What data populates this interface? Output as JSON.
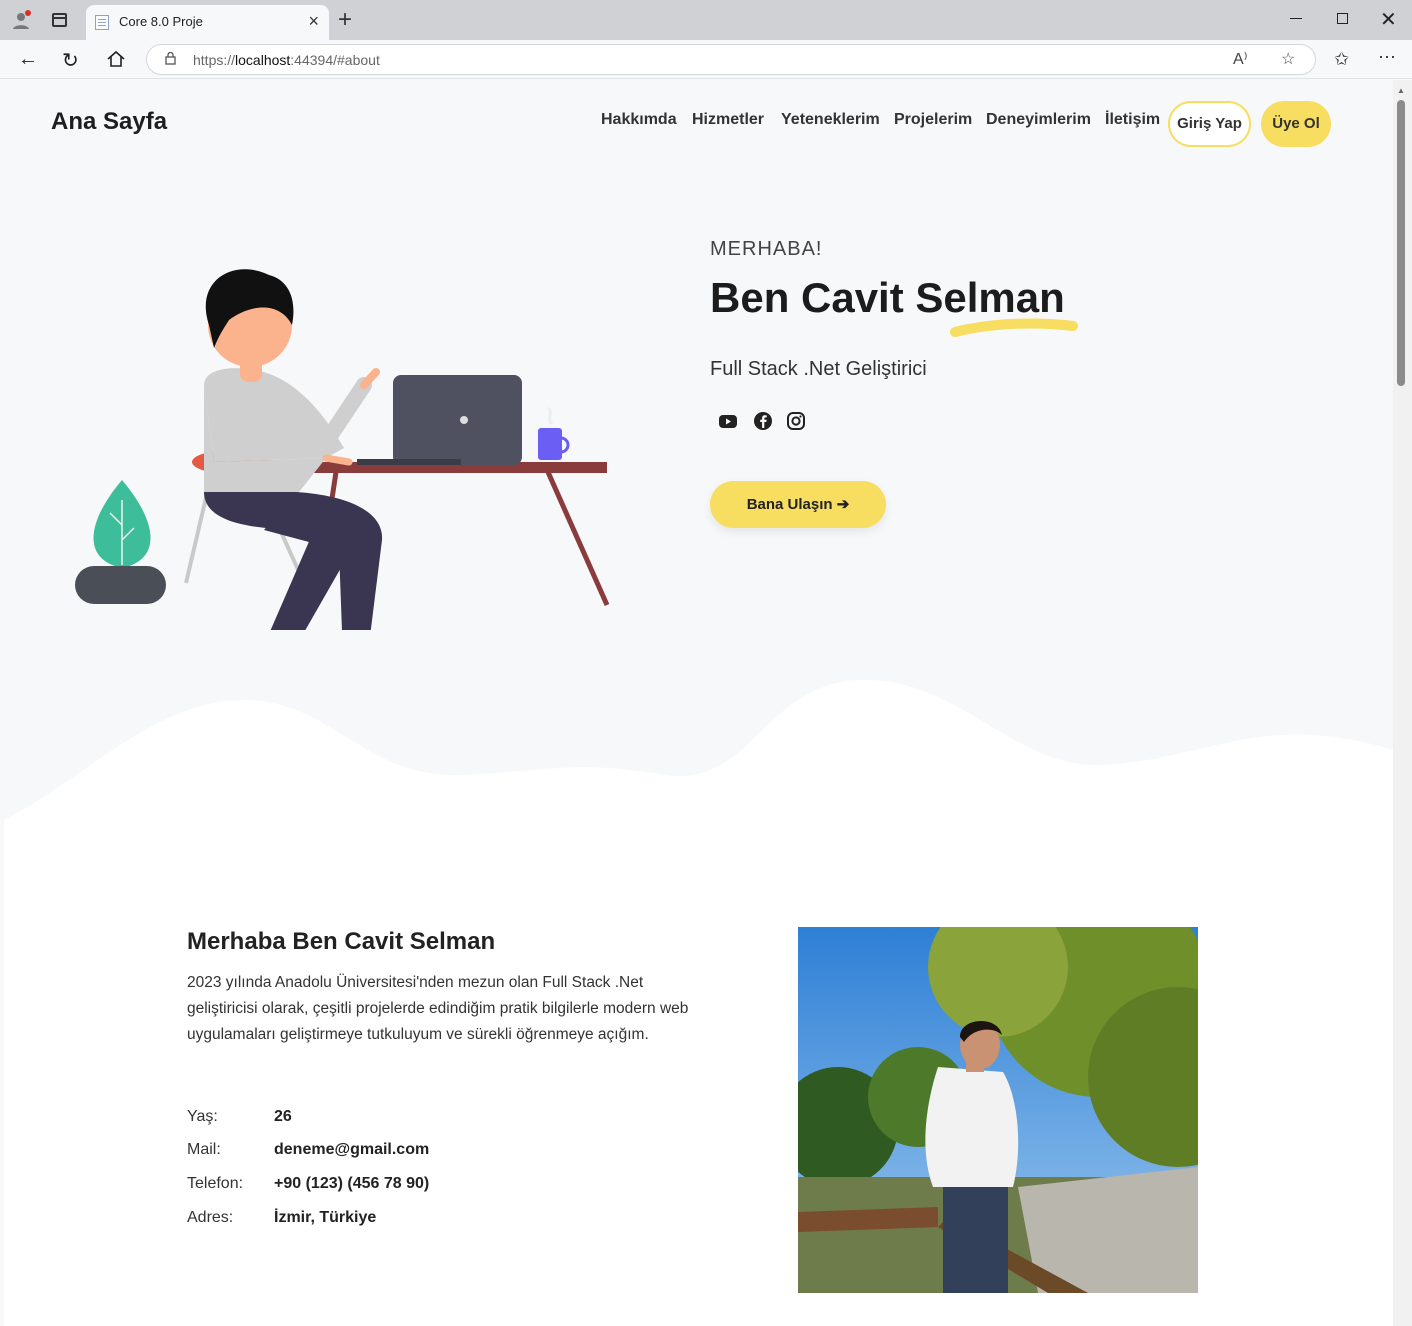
{
  "browser": {
    "tab_title": "Core 8.0 Proje",
    "url_prefix": "https://",
    "url_host": "localhost",
    "url_rest": ":44394/#about"
  },
  "nav": {
    "brand": "Ana Sayfa",
    "items": [
      "Hakkımda",
      "Hizmetler",
      "Yeteneklerim",
      "Projelerim",
      "Deneyimlerim",
      "İletişim"
    ],
    "login": "Giriş Yap",
    "signup": "Üye Ol"
  },
  "hero": {
    "greeting": "MERHABA!",
    "name": "Ben Cavit Selman",
    "role": "Full Stack .Net Geliştirici",
    "social_icons": [
      "youtube-icon",
      "facebook-icon",
      "instagram-icon"
    ],
    "cta": "Bana Ulaşın"
  },
  "about": {
    "title": "Merhaba Ben Cavit Selman",
    "text": "2023 yılında Anadolu Üniversitesi'nden mezun olan Full Stack .Net geliştiricisi olarak, çeşitli projelerde edindiğim pratik bilgilerle modern web uygulamaları geliştirmeye tutkuluyum ve sürekli öğrenmeye açığım.",
    "info": [
      {
        "label": "Yaş:",
        "value": "26"
      },
      {
        "label": "Mail:",
        "value": "deneme@gmail.com"
      },
      {
        "label": "Telefon:",
        "value": "+90 (123) (456 78 90)"
      },
      {
        "label": "Adres:",
        "value": "İzmir, Türkiye"
      }
    ]
  },
  "colors": {
    "accent": "#f7dd60",
    "hero_bg": "#f7f8fa"
  }
}
